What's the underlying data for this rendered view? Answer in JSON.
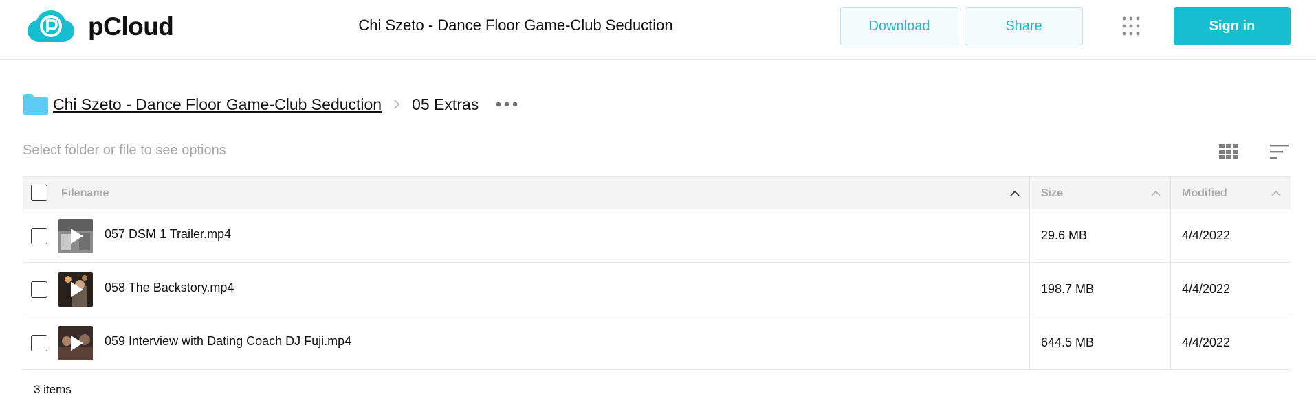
{
  "header": {
    "brand": "pCloud",
    "title": "Chi Szeto - Dance Floor Game-Club Seduction",
    "download_label": "Download",
    "share_label": "Share",
    "signin_label": "Sign in",
    "apps_icon": "apps-grid-icon",
    "accent_color": "#17bed0"
  },
  "breadcrumb": {
    "root_label": "Chi Szeto - Dance Floor Game-Club Seduction",
    "current_label": "05 Extras",
    "folder_icon": "folder-icon",
    "folder_color": "#5ecbf6"
  },
  "toolbar": {
    "hint": "Select folder or file to see options",
    "grid_icon": "grid-view-icon",
    "sort_icon": "sort-icon"
  },
  "table": {
    "columns": [
      "Filename",
      "Size",
      "Modified"
    ],
    "rows": [
      {
        "name": "057 DSM 1 Trailer.mp4",
        "size": "29.6 MB",
        "modified": "4/4/2022"
      },
      {
        "name": "058 The Backstory.mp4",
        "size": "198.7 MB",
        "modified": "4/4/2022"
      },
      {
        "name": "059 Interview with Dating Coach DJ Fuji.mp4",
        "size": "644.5 MB",
        "modified": "4/4/2022"
      }
    ]
  },
  "footer": {
    "item_count": "3 items"
  }
}
